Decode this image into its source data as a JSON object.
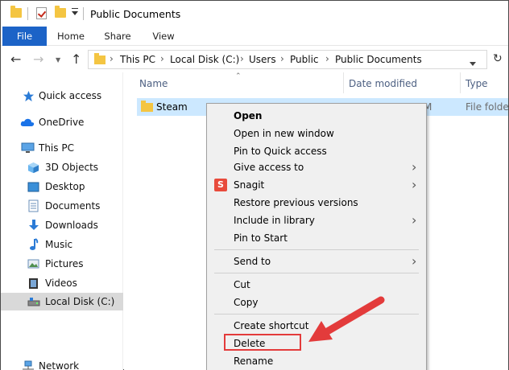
{
  "window": {
    "title": "Public Documents"
  },
  "ribbon": {
    "tabs": [
      "File",
      "Home",
      "Share",
      "View"
    ]
  },
  "address": {
    "crumbs": [
      "This PC",
      "Local Disk (C:)",
      "Users",
      "Public",
      "Public Documents"
    ]
  },
  "navpane": {
    "items": [
      {
        "label": "Quick access",
        "icon": "star-icon"
      },
      {
        "label": "OneDrive",
        "icon": "cloud-icon"
      },
      {
        "label": "This PC",
        "icon": "computer-icon"
      },
      {
        "label": "3D Objects",
        "icon": "cube-icon"
      },
      {
        "label": "Desktop",
        "icon": "desktop-icon"
      },
      {
        "label": "Documents",
        "icon": "documents-icon"
      },
      {
        "label": "Downloads",
        "icon": "download-icon"
      },
      {
        "label": "Music",
        "icon": "music-icon"
      },
      {
        "label": "Pictures",
        "icon": "pictures-icon"
      },
      {
        "label": "Videos",
        "icon": "videos-icon"
      },
      {
        "label": "Local Disk (C:)",
        "icon": "drive-icon",
        "selected": true
      },
      {
        "label": "Network",
        "icon": "network-icon"
      }
    ]
  },
  "filelist": {
    "columns": [
      "Name",
      "Date modified",
      "Type"
    ],
    "rows": [
      {
        "name": "Steam",
        "date_fragment": "M",
        "type": "File folder"
      }
    ]
  },
  "context_menu": {
    "items": [
      {
        "label": "Open",
        "bold": true
      },
      {
        "label": "Open in new window"
      },
      {
        "label": "Pin to Quick access"
      },
      {
        "label": "Give access to",
        "submenu": true
      },
      {
        "label": "Snagit",
        "submenu": true,
        "icon": "snagit-icon"
      },
      {
        "label": "Restore previous versions"
      },
      {
        "label": "Include in library",
        "submenu": true
      },
      {
        "label": "Pin to Start"
      },
      {
        "label": "Send to",
        "submenu": true
      },
      {
        "label": "Cut"
      },
      {
        "label": "Copy"
      },
      {
        "label": "Create shortcut"
      },
      {
        "label": "Delete",
        "highlighted": true
      },
      {
        "label": "Rename"
      }
    ]
  },
  "colors": {
    "accent_blue": "#1c63c7",
    "selection": "#cce8ff",
    "folder": "#f4c542",
    "annotation_red": "#e33b3b"
  }
}
